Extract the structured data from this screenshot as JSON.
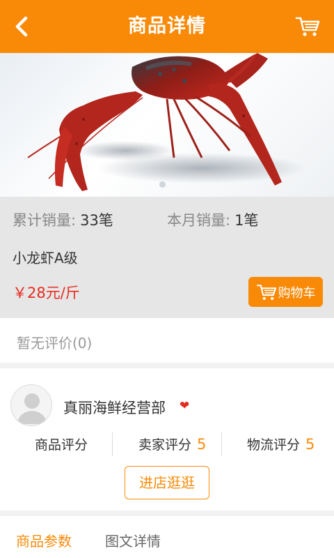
{
  "header": {
    "title": "商品详情",
    "back_icon": "chevron-left-icon",
    "cart_icon": "shopping-cart-icon",
    "accent_color": "#f98a08"
  },
  "gallery": {
    "image": "crayfish product photo",
    "current_page": 1
  },
  "product": {
    "total_sales_label": "累计销量:",
    "total_sales_value": "33笔",
    "monthly_sales_label": "本月销量:",
    "monthly_sales_value": "1笔",
    "name": "小龙虾A级",
    "price": "￥28元/斤",
    "price_color": "#e52b1f",
    "add_to_cart_label": "购物车"
  },
  "reviews": {
    "summary": "暂无评价(0)"
  },
  "shop": {
    "name": "真丽海鲜经营部",
    "favorite_icon": "heart-icon",
    "ratings": [
      {
        "label": "商品评分",
        "score": ""
      },
      {
        "label": "卖家评分",
        "score": "5"
      },
      {
        "label": "物流评分",
        "score": "5"
      }
    ],
    "visit_label": "进店逛逛"
  },
  "tabs": [
    {
      "label": "商品参数",
      "active": true
    },
    {
      "label": "图文详情",
      "active": false
    }
  ]
}
